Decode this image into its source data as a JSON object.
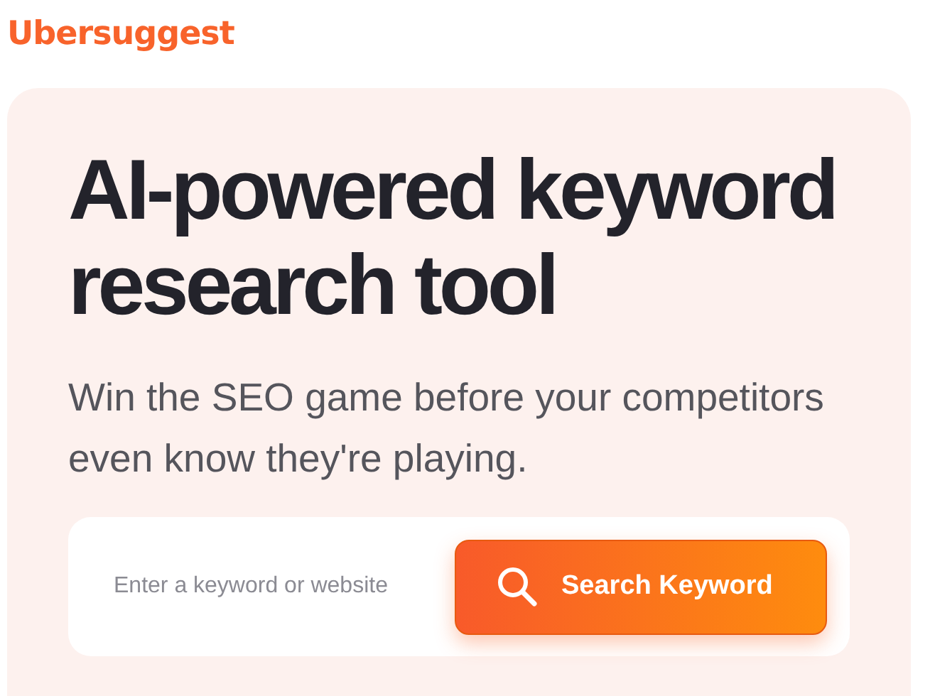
{
  "logo": "Ubersuggest",
  "hero": {
    "title": "AI-powered keyword research tool",
    "subtitle": "Win the SEO game before your competitors even know they're playing."
  },
  "search": {
    "placeholder": "Enter a keyword or website",
    "button": "Search Keyword"
  }
}
